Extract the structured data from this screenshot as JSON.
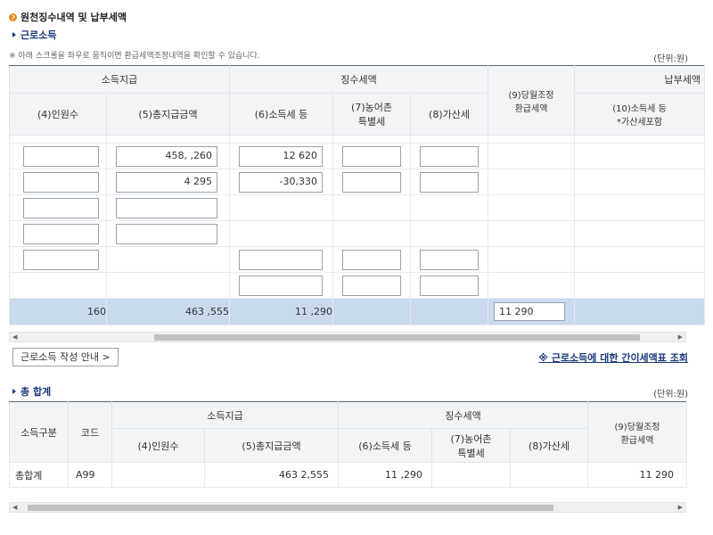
{
  "section_title": "원천징수내역 및 납부세액",
  "labor": {
    "title": "근로소득",
    "note": "※ 아래 스크롤을 좌우로 움직이면 환급세액조정내역을 확인할 수 있습니다.",
    "unit": "(단위:원)",
    "headers": {
      "income_payment": "소득지급",
      "withholding_tax": "징수세액",
      "payable_tax": "납부세액",
      "refund_adjust": "(9)당월조정\n환급세액",
      "col4": "(4)인원수",
      "col5": "(5)총지급금액",
      "col6": "(6)소득세 등",
      "col7": "(7)농어촌\n특별세",
      "col8": "(8)가산세",
      "col10": "(10)소득세 등\n*가산세포함"
    },
    "rows": [
      {
        "c4": "",
        "c5": "458,  ,260",
        "c6": "12   620",
        "c7": "",
        "c8": ""
      },
      {
        "c4": "",
        "c5": "4    295",
        "c6": "-30,330",
        "c7": "",
        "c8": ""
      },
      {
        "c4": "",
        "c5": "",
        "c6": "",
        "c7": "",
        "c8": ""
      },
      {
        "c4": "",
        "c5": "",
        "c6": "",
        "c7": "",
        "c8": ""
      },
      {
        "c4": "",
        "c5": "",
        "c6": "",
        "c7": "",
        "c8": ""
      },
      {
        "c4": "",
        "c5": "",
        "c6": "",
        "c7": "",
        "c8": ""
      }
    ],
    "sum": {
      "c4": "160",
      "c5": "463    ,555",
      "c6": "11    ,290",
      "c9": "11      290"
    },
    "guide_button": "근로소득 작성 안내 >",
    "simple_tax_link": "※ 근로소득에 대한 간이세액표 조회"
  },
  "total": {
    "title": "총 합계",
    "unit": "(단위:원)",
    "headers": {
      "income_type": "소득구분",
      "code": "코드",
      "income_payment": "소득지급",
      "withholding_tax": "징수세액",
      "refund_adjust": "(9)당월조정\n환급세액",
      "col4": "(4)인원수",
      "col5": "(5)총지급금액",
      "col6": "(6)소득세 등",
      "col7": "(7)농어촌\n특별세",
      "col8": "(8)가산세"
    },
    "row": {
      "type": "총합계",
      "code": "A99",
      "c4": "",
      "c5": "463   2,555",
      "c6": "11    ,290",
      "c7": "",
      "c8": "",
      "c9": "11      290"
    }
  },
  "colors": {
    "accent": "#1b3a7a",
    "sum_row": "#c9d9ee",
    "bullet": "#f28a1e"
  }
}
